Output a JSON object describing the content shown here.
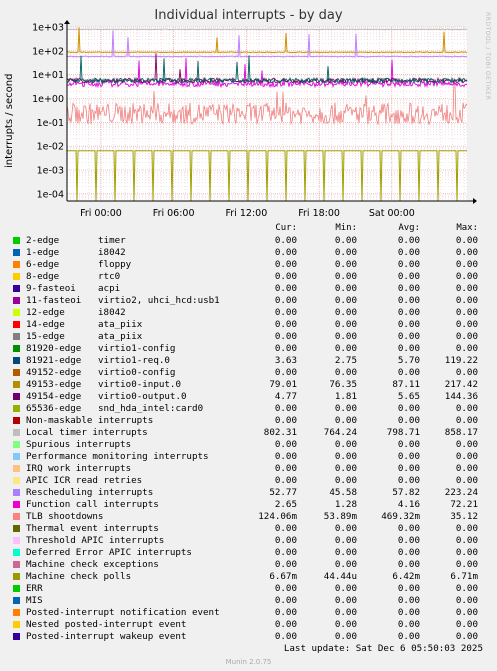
{
  "title": "Individual interrupts - by day",
  "watermark": "RRDTOOL / TOBI OETIKER",
  "footer": {
    "last_update": "Last update: Sat Dec  6 05:50:03 2025",
    "version": "Munin 2.0.75"
  },
  "legend_header": {
    "cur": "Cur:",
    "min": "Min:",
    "avg": "Avg:",
    "max": "Max:"
  },
  "chart_data": {
    "type": "line",
    "title": "Individual interrupts - by day",
    "ylabel": "interrupts / second",
    "yscale": "log",
    "ylim": [
      5e-05,
      1000
    ],
    "y_ticks": [
      "1e+03",
      "1e+02",
      "1e+01",
      "1e+00",
      "1e-01",
      "1e-02",
      "1e-03",
      "1e-04"
    ],
    "x_ticks": [
      "Fri 00:00",
      "Fri 06:00",
      "Fri 12:00",
      "Fri 18:00",
      "Sat 00:00"
    ],
    "grid": true,
    "series_summary": [
      {
        "name": "Local timer interrupts",
        "color": "#b8b8b8",
        "typical": 798.71
      },
      {
        "name": "virtio0-input.0",
        "color": "#d09000",
        "typical": 87.11
      },
      {
        "name": "Rescheduling interrupts",
        "color": "#c080ff",
        "typical": 57.82
      },
      {
        "name": "virtio1-req.0",
        "color": "#006060",
        "typical": 5.7
      },
      {
        "name": "virtio0-output.0",
        "color": "#800060",
        "typical": 5.65
      },
      {
        "name": "Function call interrupts",
        "color": "#e000e0",
        "typical": 4.16
      },
      {
        "name": "TLB shootdowns",
        "color": "#f08080",
        "typical": 0.469
      },
      {
        "name": "Machine check polls",
        "color": "#a0a000",
        "typical": 0.00642
      }
    ]
  },
  "legend": [
    {
      "name": "2-edge",
      "dev": "timer",
      "color": "#00cc00",
      "cur": "0.00",
      "min": "0.00",
      "avg": "0.00",
      "max": "0.00"
    },
    {
      "name": "1-edge",
      "dev": "i8042",
      "color": "#0066b3",
      "cur": "0.00",
      "min": "0.00",
      "avg": "0.00",
      "max": "0.00"
    },
    {
      "name": "6-edge",
      "dev": "floppy",
      "color": "#ff8000",
      "cur": "0.00",
      "min": "0.00",
      "avg": "0.00",
      "max": "0.00"
    },
    {
      "name": "8-edge",
      "dev": "rtc0",
      "color": "#ffcc00",
      "cur": "0.00",
      "min": "0.00",
      "avg": "0.00",
      "max": "0.00"
    },
    {
      "name": "9-fasteoi",
      "dev": "acpi",
      "color": "#330099",
      "cur": "0.00",
      "min": "0.00",
      "avg": "0.00",
      "max": "0.00"
    },
    {
      "name": "11-fasteoi",
      "dev": "virtio2, uhci_hcd:usb1",
      "color": "#990099",
      "cur": "0.00",
      "min": "0.00",
      "avg": "0.00",
      "max": "0.00"
    },
    {
      "name": "12-edge",
      "dev": "i8042",
      "color": "#ccff00",
      "cur": "0.00",
      "min": "0.00",
      "avg": "0.00",
      "max": "0.00"
    },
    {
      "name": "14-edge",
      "dev": "ata_piix",
      "color": "#ff0000",
      "cur": "0.00",
      "min": "0.00",
      "avg": "0.00",
      "max": "0.00"
    },
    {
      "name": "15-edge",
      "dev": "ata_piix",
      "color": "#808080",
      "cur": "0.00",
      "min": "0.00",
      "avg": "0.00",
      "max": "0.00"
    },
    {
      "name": "81920-edge",
      "dev": "virtio1-config",
      "color": "#008f00",
      "cur": "0.00",
      "min": "0.00",
      "avg": "0.00",
      "max": "0.00"
    },
    {
      "name": "81921-edge",
      "dev": "virtio1-req.0",
      "color": "#00487d",
      "cur": "3.63",
      "min": "2.75",
      "avg": "5.70",
      "max": "119.22"
    },
    {
      "name": "49152-edge",
      "dev": "virtio0-config",
      "color": "#b35a00",
      "cur": "0.00",
      "min": "0.00",
      "avg": "0.00",
      "max": "0.00"
    },
    {
      "name": "49153-edge",
      "dev": "virtio0-input.0",
      "color": "#b38f00",
      "cur": "79.01",
      "min": "76.35",
      "avg": "87.11",
      "max": "217.42"
    },
    {
      "name": "49154-edge",
      "dev": "virtio0-output.0",
      "color": "#6b006b",
      "cur": "4.77",
      "min": "1.81",
      "avg": "5.65",
      "max": "144.36"
    },
    {
      "name": "65536-edge",
      "dev": "snd_hda_intel:card0",
      "color": "#8fb300",
      "cur": "0.00",
      "min": "0.00",
      "avg": "0.00",
      "max": "0.00"
    },
    {
      "name": "Non-maskable interrupts",
      "dev": "",
      "color": "#b30000",
      "cur": "0.00",
      "min": "0.00",
      "avg": "0.00",
      "max": "0.00"
    },
    {
      "name": "Local timer interrupts",
      "dev": "",
      "color": "#bebebe",
      "cur": "802.31",
      "min": "764.24",
      "avg": "798.71",
      "max": "858.17"
    },
    {
      "name": "Spurious interrupts",
      "dev": "",
      "color": "#80ff80",
      "cur": "0.00",
      "min": "0.00",
      "avg": "0.00",
      "max": "0.00"
    },
    {
      "name": "Performance monitoring interrupts",
      "dev": "",
      "color": "#80c9ff",
      "cur": "0.00",
      "min": "0.00",
      "avg": "0.00",
      "max": "0.00"
    },
    {
      "name": "IRQ work interrupts",
      "dev": "",
      "color": "#ffc080",
      "cur": "0.00",
      "min": "0.00",
      "avg": "0.00",
      "max": "0.00"
    },
    {
      "name": "APIC ICR read retries",
      "dev": "",
      "color": "#ffe680",
      "cur": "0.00",
      "min": "0.00",
      "avg": "0.00",
      "max": "0.00"
    },
    {
      "name": "Rescheduling interrupts",
      "dev": "",
      "color": "#aa80ff",
      "cur": "52.77",
      "min": "45.58",
      "avg": "57.82",
      "max": "223.24"
    },
    {
      "name": "Function call interrupts",
      "dev": "",
      "color": "#ee00cc",
      "cur": "2.65",
      "min": "1.28",
      "avg": "4.16",
      "max": "72.21"
    },
    {
      "name": "TLB shootdowns",
      "dev": "",
      "color": "#ff8080",
      "cur": "124.06m",
      "min": "53.89m",
      "avg": "469.32m",
      "max": "35.12"
    },
    {
      "name": "Thermal event interrupts",
      "dev": "",
      "color": "#666600",
      "cur": "0.00",
      "min": "0.00",
      "avg": "0.00",
      "max": "0.00"
    },
    {
      "name": "Threshold APIC interrupts",
      "dev": "",
      "color": "#ffbfff",
      "cur": "0.00",
      "min": "0.00",
      "avg": "0.00",
      "max": "0.00"
    },
    {
      "name": "Deferred Error APIC interrupts",
      "dev": "",
      "color": "#00ffcc",
      "cur": "0.00",
      "min": "0.00",
      "avg": "0.00",
      "max": "0.00"
    },
    {
      "name": "Machine check exceptions",
      "dev": "",
      "color": "#cc6699",
      "cur": "0.00",
      "min": "0.00",
      "avg": "0.00",
      "max": "0.00"
    },
    {
      "name": "Machine check polls",
      "dev": "",
      "color": "#999900",
      "cur": "6.67m",
      "min": "44.44u",
      "avg": "6.42m",
      "max": "6.71m"
    },
    {
      "name": "ERR",
      "dev": "",
      "color": "#00cc00",
      "cur": "0.00",
      "min": "0.00",
      "avg": "0.00",
      "max": "0.00"
    },
    {
      "name": "MIS",
      "dev": "",
      "color": "#0066b3",
      "cur": "0.00",
      "min": "0.00",
      "avg": "0.00",
      "max": "0.00"
    },
    {
      "name": "Posted-interrupt notification event",
      "dev": "",
      "color": "#ff8000",
      "cur": "0.00",
      "min": "0.00",
      "avg": "0.00",
      "max": "0.00"
    },
    {
      "name": "Nested posted-interrupt event",
      "dev": "",
      "color": "#ffcc00",
      "cur": "0.00",
      "min": "0.00",
      "avg": "0.00",
      "max": "0.00"
    },
    {
      "name": "Posted-interrupt wakeup event",
      "dev": "",
      "color": "#330099",
      "cur": "0.00",
      "min": "0.00",
      "avg": "0.00",
      "max": "0.00"
    }
  ]
}
